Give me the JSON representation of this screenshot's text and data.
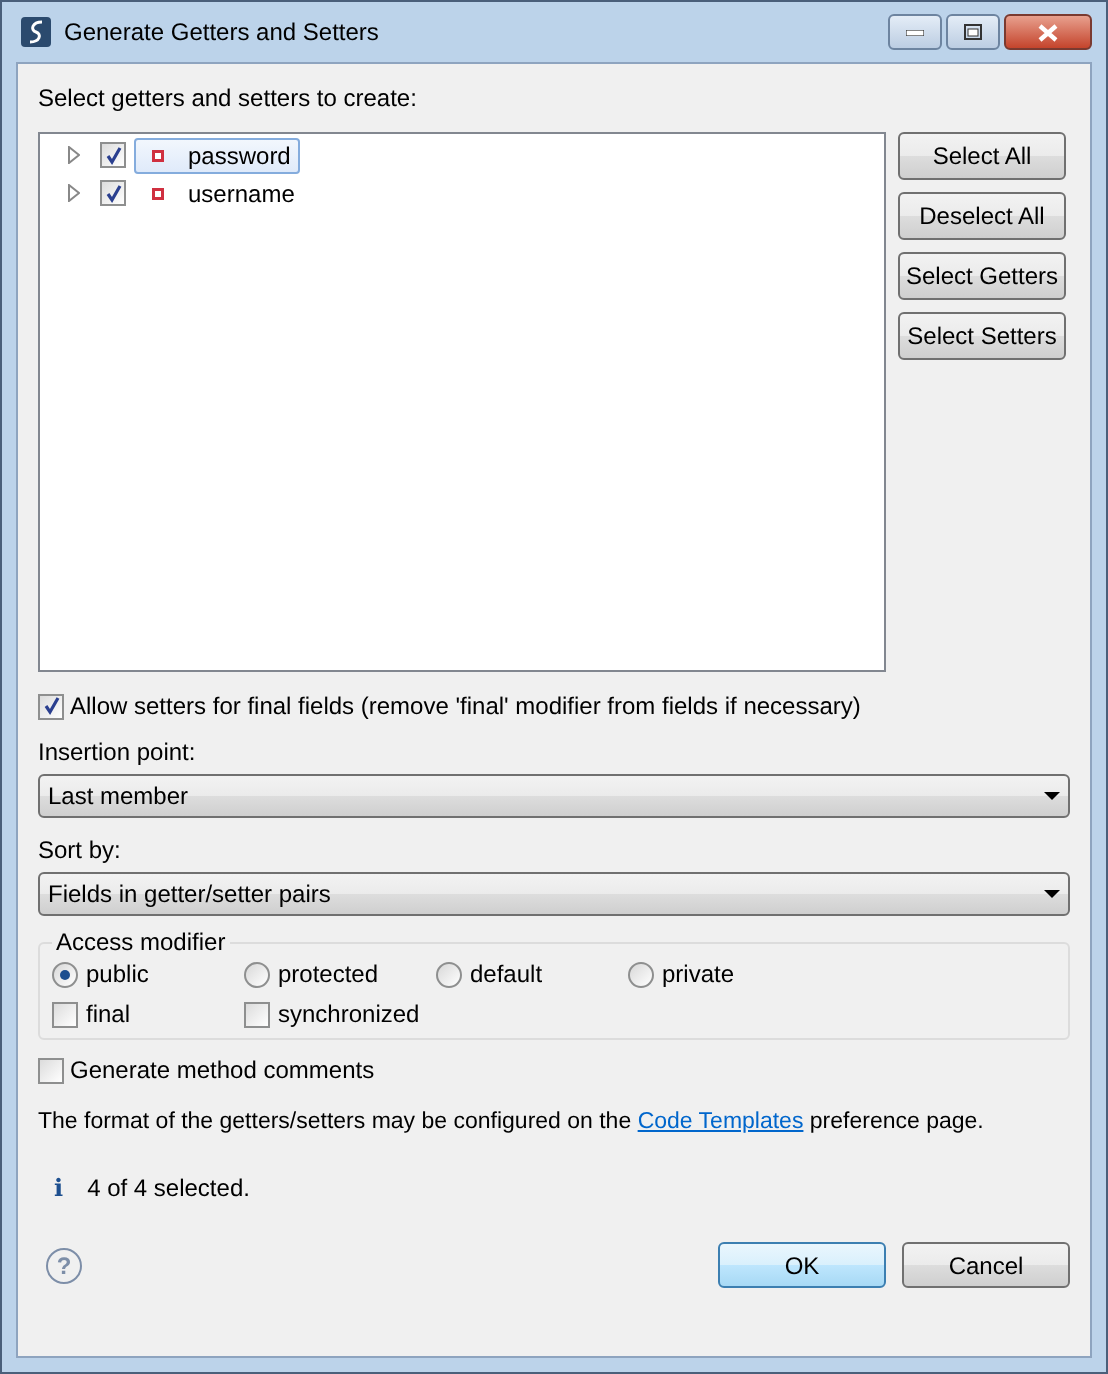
{
  "window": {
    "title": "Generate Getters and Setters"
  },
  "tree": {
    "label": "Select getters and setters to create:",
    "items": [
      {
        "name": "password",
        "checked": true,
        "selected": true,
        "expanded": false
      },
      {
        "name": "username",
        "checked": true,
        "selected": false,
        "expanded": false
      }
    ]
  },
  "side_buttons": [
    "Select All",
    "Deselect All",
    "Select Getters",
    "Select Setters"
  ],
  "allow_final": {
    "label": "Allow setters for final fields (remove 'final' modifier from fields if necessary)",
    "checked": true
  },
  "insertion_point": {
    "label": "Insertion point:",
    "value": "Last member"
  },
  "sort_by": {
    "label": "Sort by:",
    "value": "Fields in getter/setter pairs"
  },
  "access_modifier": {
    "title": "Access modifier",
    "radios": [
      {
        "label": "public",
        "selected": true
      },
      {
        "label": "protected",
        "selected": false
      },
      {
        "label": "default",
        "selected": false
      },
      {
        "label": "private",
        "selected": false
      }
    ],
    "checks": [
      {
        "label": "final",
        "checked": false
      },
      {
        "label": "synchronized",
        "checked": false
      }
    ]
  },
  "generate_comments": {
    "label": "Generate method comments",
    "checked": false
  },
  "format_note": {
    "before": "The format of the getters/setters may be configured on the",
    "link": "Code Templates",
    "after": "preference page."
  },
  "status": {
    "glyph": "i",
    "text": "4 of 4 selected."
  },
  "help": {
    "glyph": "?"
  },
  "buttons": [
    {
      "label": "OK",
      "default": true
    },
    {
      "label": "Cancel",
      "default": false
    }
  ]
}
